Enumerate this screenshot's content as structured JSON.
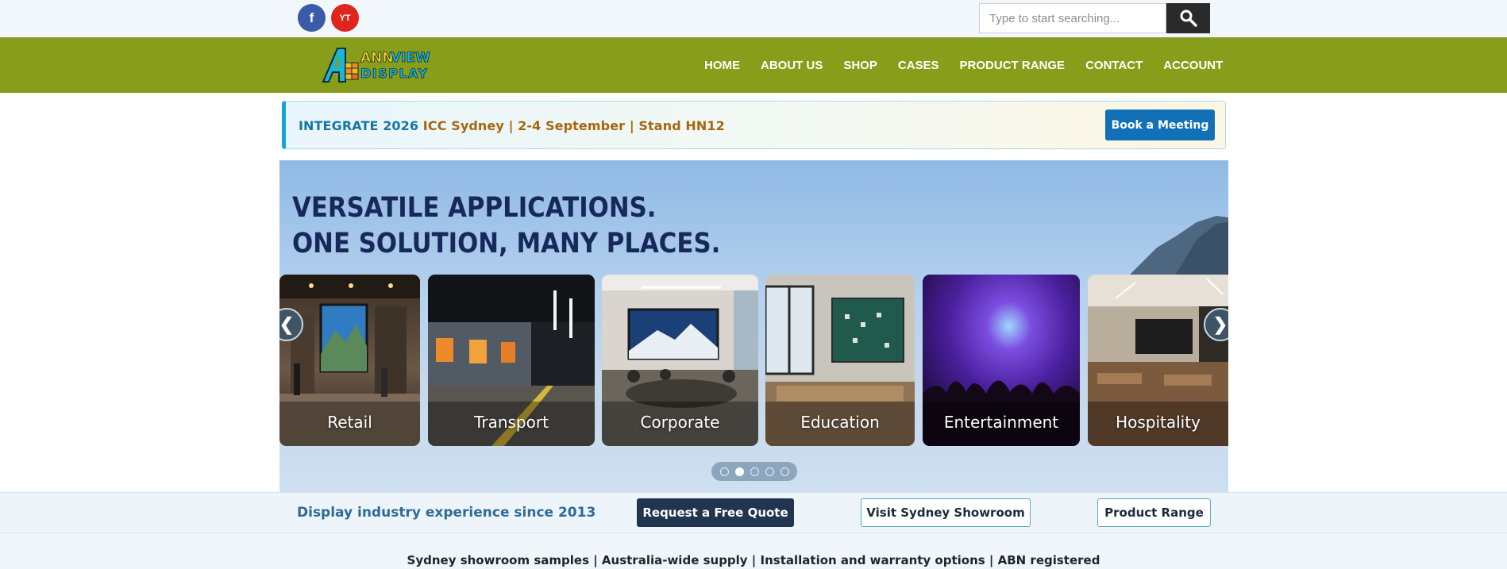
{
  "topbar": {
    "social": {
      "facebook_label": "f",
      "youtube_label": "YT"
    },
    "search": {
      "placeholder": "Type to start searching...",
      "value": ""
    }
  },
  "header": {
    "logo": {
      "line1_ann": "ANN",
      "line1_view": "VIEW",
      "line2": "DISPLAY"
    },
    "nav": [
      "HOME",
      "ABOUT US",
      "SHOP",
      "CASES",
      "PRODUCT RANGE",
      "CONTACT",
      "ACCOUNT"
    ]
  },
  "event_banner": {
    "highlight": "INTEGRATE 2026",
    "details": " ICC Sydney | 2-4 September | Stand HN12",
    "button": "Book a Meeting"
  },
  "hero": {
    "title_line1": "VERSATILE APPLICATIONS.",
    "title_line2": "ONE SOLUTION, MANY PLACES.",
    "prev_label": "❮",
    "next_label": "❯",
    "cards": [
      "Retail",
      "Transport",
      "Corporate",
      "Education",
      "Entertainment",
      "Hospitality"
    ],
    "slide_count": 5,
    "active_slide": 2
  },
  "cta": {
    "since": "Display industry experience since 2013",
    "quote_button": "Request a Free Quote",
    "showroom_button": "Visit Sydney Showroom",
    "range_button": "Product Range"
  },
  "footer": {
    "trust_line": "Sydney showroom samples | Australia-wide supply | Installation and warranty options | ABN registered"
  },
  "colors": {
    "nav_green": "#889d1a",
    "banner_accent": "#16a2d6",
    "meeting_button": "#1170b6",
    "hero_title": "#17295a",
    "quote_button": "#1f3550"
  }
}
